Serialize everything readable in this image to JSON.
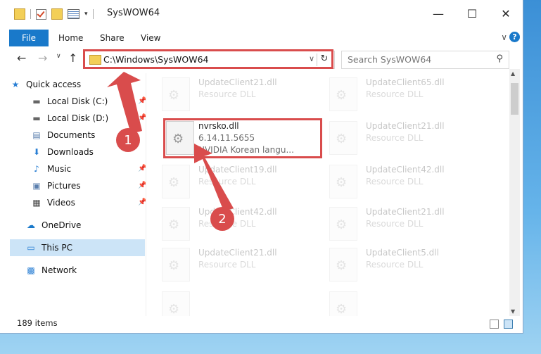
{
  "window": {
    "title": "SysWOW64"
  },
  "ribbon": {
    "tabs": [
      "File",
      "Home",
      "Share",
      "View"
    ],
    "help": "?"
  },
  "address": {
    "path": "C:\\Windows\\SysWOW64",
    "search_placeholder": "Search SysWOW64"
  },
  "sidebar": {
    "items": [
      {
        "label": "Quick access",
        "icon": "star-icon"
      },
      {
        "label": "Local Disk (C:)",
        "icon": "drive-icon"
      },
      {
        "label": "Local Disk (D:)",
        "icon": "drive-icon"
      },
      {
        "label": "Documents",
        "icon": "documents-icon"
      },
      {
        "label": "Downloads",
        "icon": "download-arrow-icon"
      },
      {
        "label": "Music",
        "icon": "music-note-icon"
      },
      {
        "label": "Pictures",
        "icon": "pictures-icon"
      },
      {
        "label": "Videos",
        "icon": "film-icon"
      },
      {
        "label": "OneDrive",
        "icon": "cloud-icon"
      },
      {
        "label": "This PC",
        "icon": "monitor-icon"
      },
      {
        "label": "Network",
        "icon": "network-icon"
      }
    ]
  },
  "files": [
    {
      "name": "UpdateClient21.dll",
      "type": "Resource DLL",
      "faded": true
    },
    {
      "name": "UpdateClient65.dll",
      "type": "Resource DLL",
      "faded": true
    },
    {
      "name": "nvrsko.dll",
      "version": "6.14.11.5655",
      "description": "NVIDIA Korean langu...",
      "faded": false
    },
    {
      "name": "UpdateClient21.dll",
      "type": "Resource DLL",
      "faded": true
    },
    {
      "name": "UpdateClient19.dll",
      "type": "Resource DLL",
      "faded": true
    },
    {
      "name": "UpdateClient42.dll",
      "type": "Resource DLL",
      "faded": true
    },
    {
      "name": "UpdateClient42.dll",
      "type": "Resource DLL",
      "faded": true
    },
    {
      "name": "UpdateClient21.dll",
      "type": "Resource DLL",
      "faded": true
    },
    {
      "name": "UpdateClient21.dll",
      "type": "Resource DLL",
      "faded": true
    },
    {
      "name": "UpdateClient5.dll",
      "type": "Resource DLL",
      "faded": true
    }
  ],
  "status": {
    "item_count": "189 items"
  },
  "annotations": {
    "marker1": "1",
    "marker2": "2",
    "color": "#d94c4c"
  }
}
